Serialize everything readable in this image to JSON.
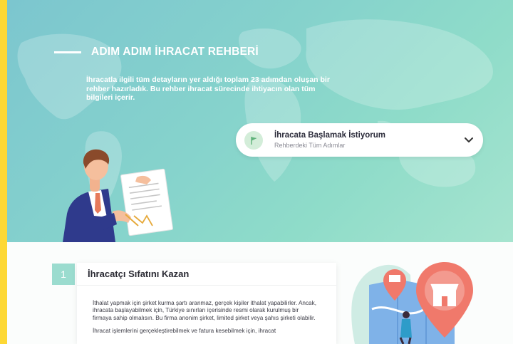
{
  "hero": {
    "title": "ADIM ADIM İHRACAT REHBERİ",
    "description": "İhracatla ilgili tüm detayların yer aldığı toplam 23 adımdan oluşan bir rehber hazırladık. Bu rehber ihracat sürecinde ihtiyacın olan tüm bilgileri içerir."
  },
  "selector": {
    "title": "İhracata Başlamak İstiyorum",
    "subtitle": "Rehberdeki Tüm Adımlar",
    "icon": "flag-icon"
  },
  "step": {
    "number": "1",
    "title": "İhracatçı Sıfatını Kazan",
    "paragraph1": "İthalat yapmak için şirket kurma şartı aranmaz, gerçek kişiler ithalat yapabilirler. Ancak, ihracata başlayabilmek için, Türkiye sınırları içerisinde resmi olarak kurulmuş bir firmaya sahip olmalısın. Bu firma anonim şirket, limited şirket veya şahıs şirketi olabilir.",
    "paragraph2": "İhracat işlemlerini gerçekleştirebilmek ve fatura kesebilmek için, ihracat"
  },
  "colors": {
    "frame": "#fdd835",
    "accent": "#9bdccf",
    "pin": "#f0796b"
  }
}
